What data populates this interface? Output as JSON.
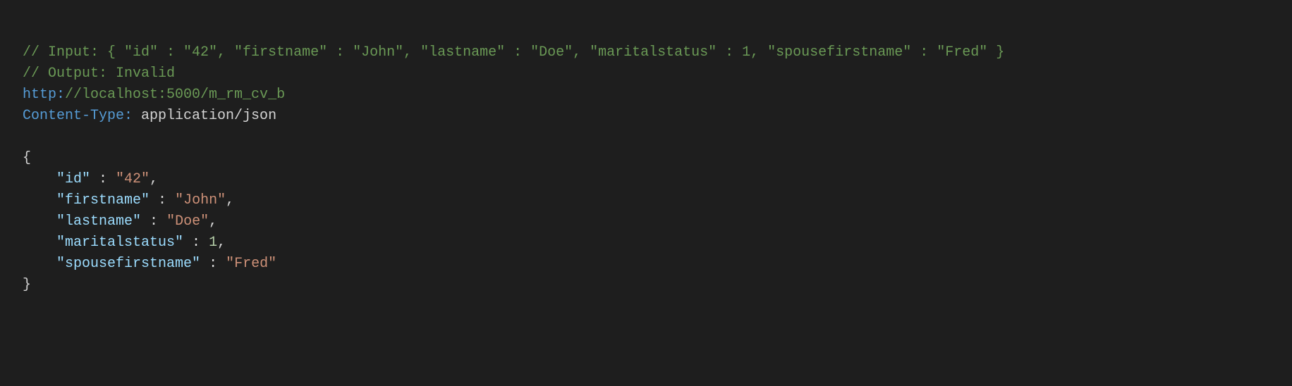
{
  "comments": {
    "input": "// Input: { \"id\" : \"42\", \"firstname\" : \"John\", \"lastname\" : \"Doe\", \"maritalstatus\" : 1, \"spousefirstname\" : \"Fred\" }",
    "output": "// Output: Invalid"
  },
  "request": {
    "url_scheme": "http:",
    "url_rest": "//localhost:5000/m_rm_cv_b",
    "header_name": "Content-Type:",
    "header_value": " application/json"
  },
  "body": {
    "open_brace": "{",
    "close_brace": "}",
    "indent": "    ",
    "entries": [
      {
        "key": "\"id\"",
        "sep": " : ",
        "value": "\"42\"",
        "type": "string",
        "comma": ","
      },
      {
        "key": "\"firstname\"",
        "sep": " : ",
        "value": "\"John\"",
        "type": "string",
        "comma": ","
      },
      {
        "key": "\"lastname\"",
        "sep": " : ",
        "value": "\"Doe\"",
        "type": "string",
        "comma": ","
      },
      {
        "key": "\"maritalstatus\"",
        "sep": " : ",
        "value": "1",
        "type": "number",
        "comma": ","
      },
      {
        "key": "\"spousefirstname\"",
        "sep": " : ",
        "value": "\"Fred\"",
        "type": "string",
        "comma": ""
      }
    ]
  }
}
